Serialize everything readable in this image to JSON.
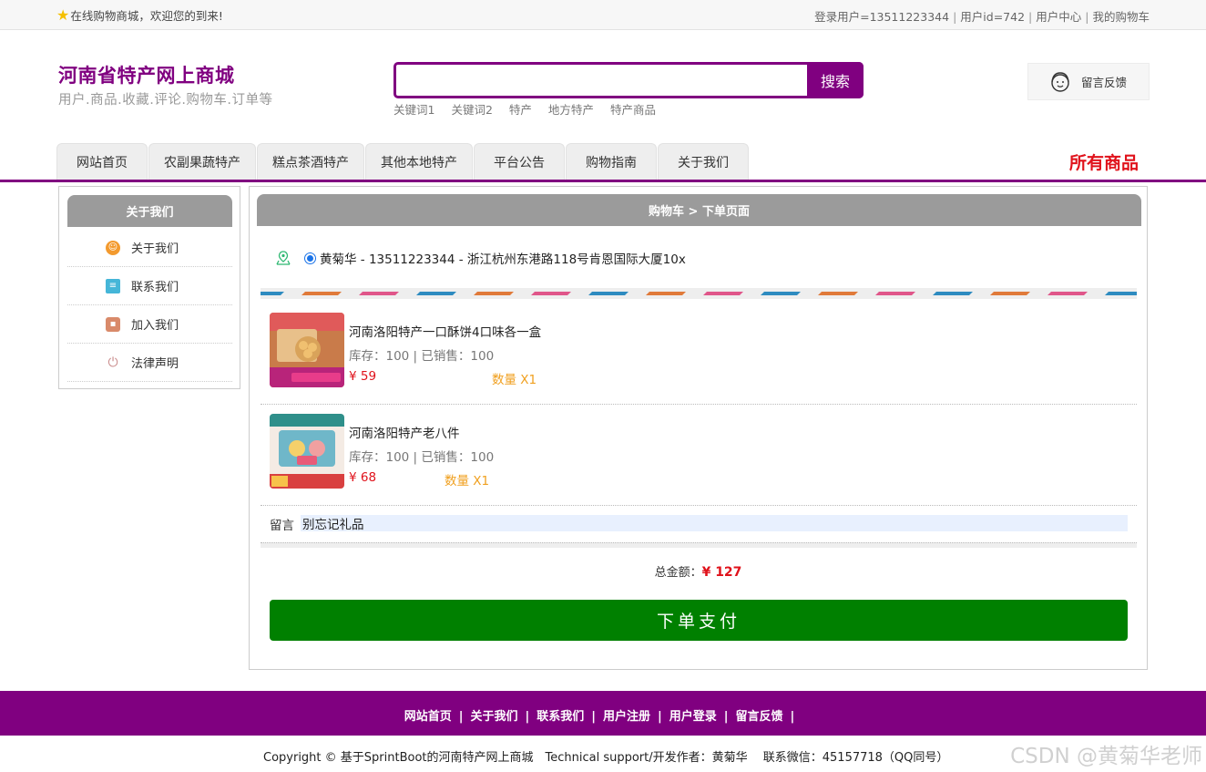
{
  "topbar": {
    "welcome": "在线购物商城，欢迎您的到来!",
    "login_user": "登录用户=13511223344",
    "user_id": "用户id=742",
    "user_center": "用户中心",
    "my_cart": "我的购物车"
  },
  "header": {
    "title": "河南省特产网上商城",
    "subtitle": "用户.商品.收藏.评论.购物车.订单等",
    "search_value": "",
    "search_button": "搜索",
    "hot_words": [
      "关键词1",
      "关键词2",
      "特产",
      "地方特产",
      "特产商品"
    ],
    "feedback": "留言反馈"
  },
  "nav": {
    "tabs": [
      "网站首页",
      "农副果蔬特产",
      "糕点茶酒特产",
      "其他本地特产",
      "平台公告",
      "购物指南",
      "关于我们"
    ],
    "all_products": "所有商品"
  },
  "sidebar": {
    "title": "关于我们",
    "items": [
      {
        "label": "关于我们",
        "icon": "about-icon",
        "color": "#f39a2e"
      },
      {
        "label": "联系我们",
        "icon": "clipboard-icon",
        "color": "#45b6d8"
      },
      {
        "label": "加入我们",
        "icon": "lock-icon",
        "color": "#d98a6a"
      },
      {
        "label": "法律声明",
        "icon": "power-icon",
        "color": "#c98a8a"
      }
    ]
  },
  "main": {
    "breadcrumb": "购物车 > 下单页面",
    "address": "黄菊华 - 13511223344 - 浙江杭州东港路118号肯恩国际大厦10x",
    "products": [
      {
        "name": "河南洛阳特产一口酥饼4口味各一盒",
        "stock": "库存：100 | 已销售：100",
        "price": "¥ 59",
        "qty": "数量 X1"
      },
      {
        "name": "河南洛阳特产老八件",
        "stock": "库存：100 | 已销售：100",
        "price": "¥ 68",
        "qty": "数量 X1"
      }
    ],
    "message_label": "留言",
    "message_value": "别忘记礼品",
    "total_label": "总金额：",
    "total_value": "¥ 127",
    "pay_button": "下单支付"
  },
  "footer": {
    "links": [
      "网站首页",
      "关于我们",
      "联系我们",
      "用户注册",
      "用户登录",
      "留言反馈"
    ],
    "copyright": "Copyright © 基于SprintBoot的河南特产网上商城　Technical support/开发作者：黄菊华　 联系微信：45157718（QQ同号）",
    "watermark": "CSDN @黄菊华老师"
  },
  "colors": {
    "brand": "#800080",
    "pay": "#008000",
    "price": "#e0121b",
    "qty": "#f0a020"
  }
}
